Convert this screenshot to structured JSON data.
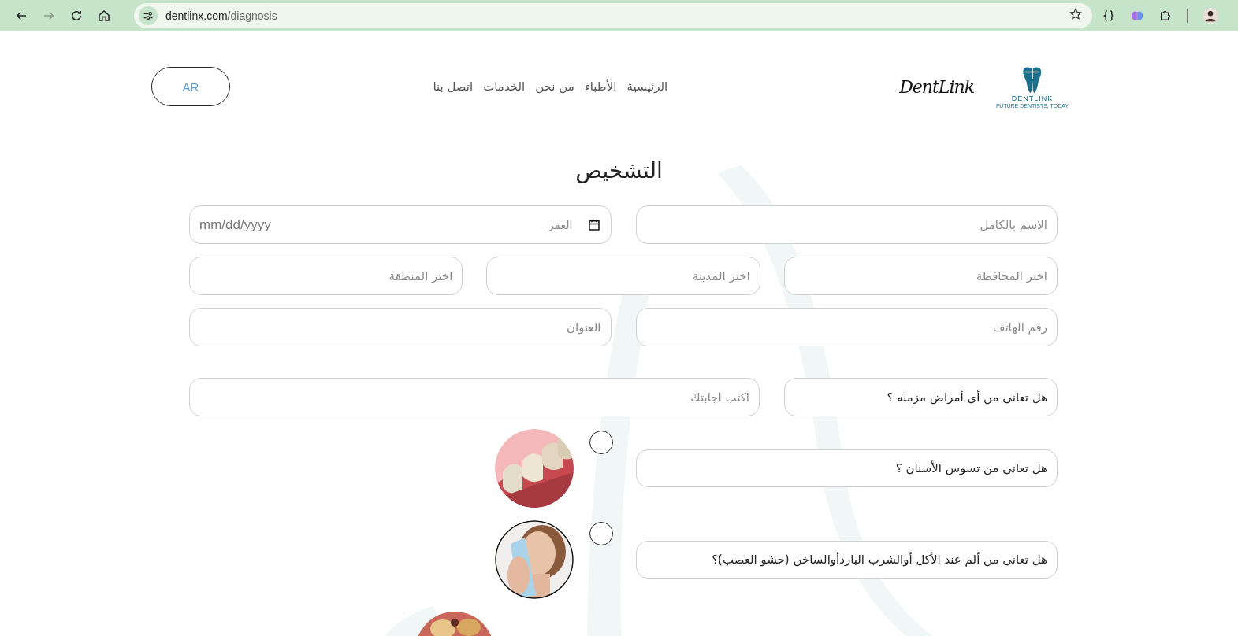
{
  "browser": {
    "back": {
      "disabled": false
    },
    "forward": {
      "disabled": true
    },
    "url_domain": "dentlinx.com",
    "url_path": "/diagnosis"
  },
  "header": {
    "language_button": "AR",
    "nav": [
      "الرئيسية",
      "الأطباء",
      "من نحن",
      "الخدمات",
      "اتصل بنا"
    ],
    "logo_script": "DentLink",
    "logo_brand": "DENTLINK",
    "logo_tagline": "FUTURE DENTISTS, TODAY"
  },
  "title": "التشخيص",
  "rows": [
    {
      "kind": "two",
      "fields": [
        {
          "kind": "text",
          "placeholder": "الاسم بالكامل"
        },
        {
          "kind": "date",
          "label": "العمر",
          "placeholder": "mm/dd/yyyy"
        }
      ]
    },
    {
      "kind": "three",
      "fields": [
        {
          "kind": "text",
          "placeholder": "اختر المحافظة"
        },
        {
          "kind": "text",
          "placeholder": "اختر المدينة"
        },
        {
          "kind": "text",
          "placeholder": "اختر المنطقة"
        }
      ]
    },
    {
      "kind": "two",
      "fields": [
        {
          "kind": "text",
          "placeholder": "رقم الهاتف"
        },
        {
          "kind": "text",
          "placeholder": "العنوان"
        }
      ]
    }
  ],
  "chronic_question": {
    "question": "هل تعانى من أى أمراض مزمنه ؟",
    "answer_placeholder": "اكتب اجابتك"
  },
  "questions": [
    {
      "question": "هل تعانى من تسوس الأسنان ؟",
      "checked": false
    },
    {
      "question": "هل تعانى من ألم عند الأكل أوالشرب الباردأوالساخن (حشو العصب)؟",
      "checked": false
    }
  ]
}
